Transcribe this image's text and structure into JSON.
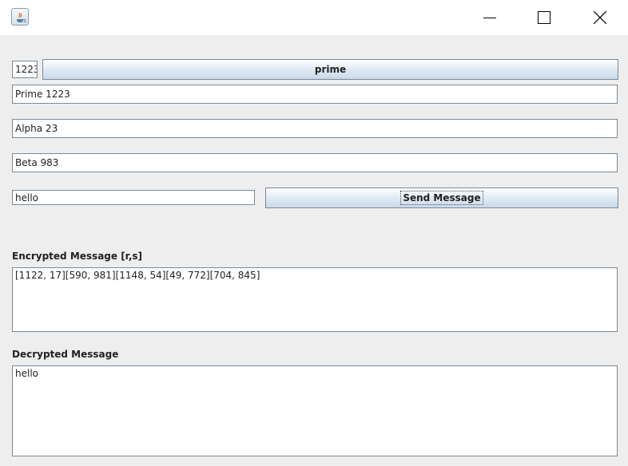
{
  "window": {
    "app_icon": "java-coffee-cup-icon",
    "controls": {
      "minimize_icon": "minimize-icon",
      "maximize_icon": "maximize-icon",
      "close_icon": "close-icon"
    }
  },
  "form": {
    "prime_input_value": "1223",
    "prime_button_label": "prime",
    "prime_field_value": "Prime 1223",
    "alpha_field_value": "Alpha 23",
    "beta_field_value": "Beta 983",
    "message_input_value": "hello",
    "send_button_label": "Send Message"
  },
  "encrypted": {
    "label": "Encrypted Message [r,s]",
    "value": "[1122, 17][590, 981][1148, 54][49, 772][704, 845]"
  },
  "decrypted": {
    "label": "Decrypted Message",
    "value": "hello"
  }
}
